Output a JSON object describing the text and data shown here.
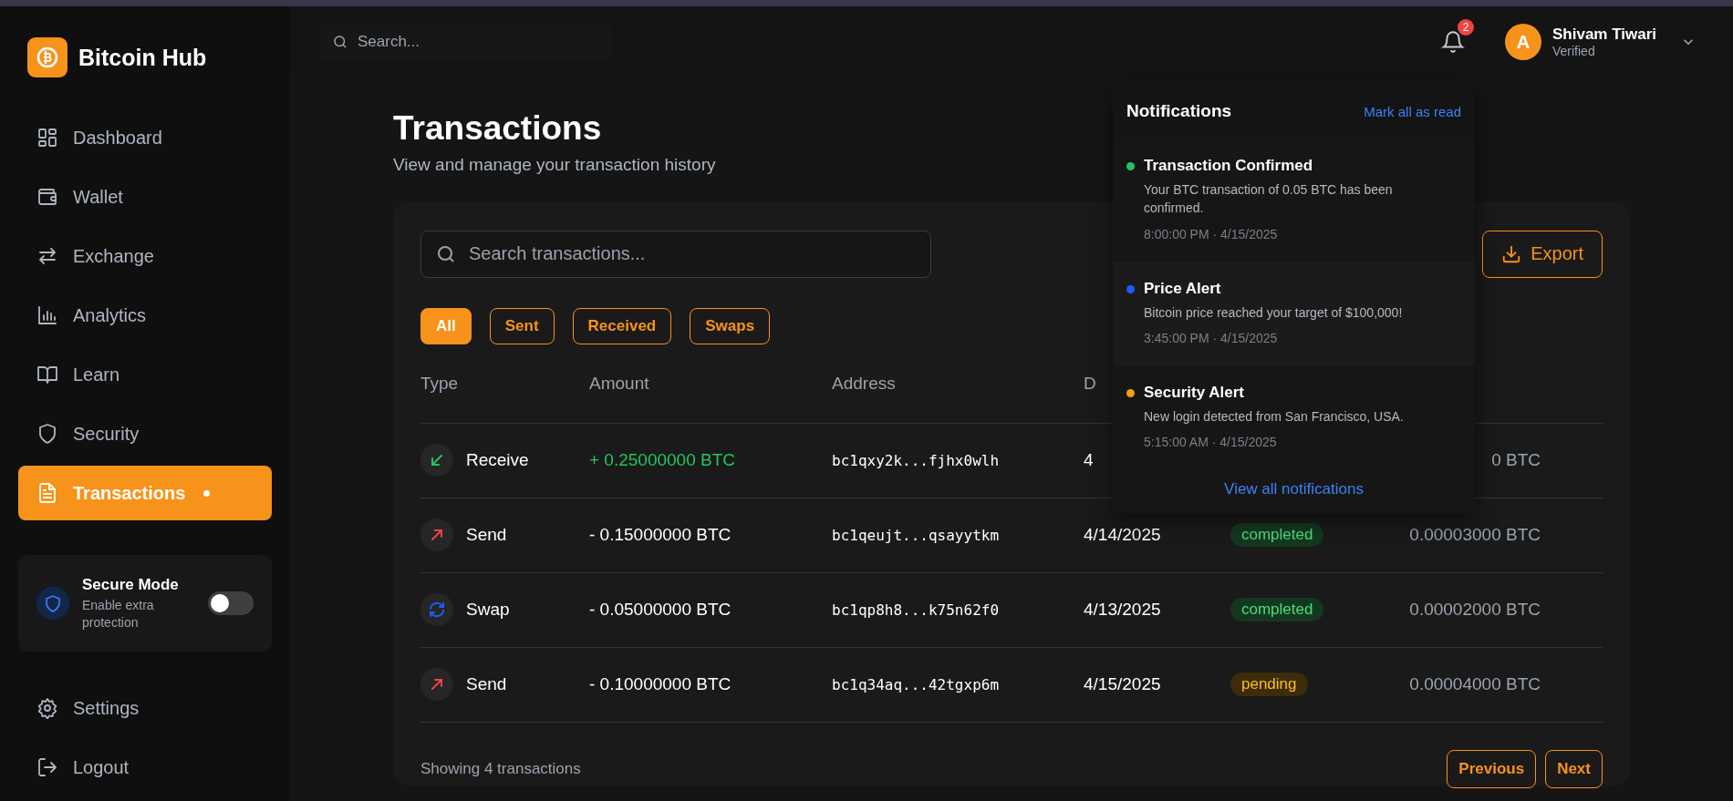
{
  "brand": {
    "name": "Bitcoin Hub"
  },
  "nav": [
    {
      "label": "Dashboard",
      "selected": false
    },
    {
      "label": "Wallet",
      "selected": false
    },
    {
      "label": "Exchange",
      "selected": false
    },
    {
      "label": "Analytics",
      "selected": false
    },
    {
      "label": "Learn",
      "selected": false
    },
    {
      "label": "Security",
      "selected": false
    },
    {
      "label": "Transactions",
      "selected": true
    }
  ],
  "secure_mode": {
    "title": "Secure Mode",
    "subtitle": "Enable extra protection",
    "on": false
  },
  "bottom_nav": [
    {
      "label": "Settings"
    },
    {
      "label": "Logout"
    }
  ],
  "top_search": {
    "placeholder": "Search..."
  },
  "notifications_badge": "2",
  "user": {
    "initial": "A",
    "name": "Shivam Tiwari",
    "status": "Verified"
  },
  "page": {
    "title": "Transactions",
    "subtitle": "View and manage your transaction history"
  },
  "tx_search": {
    "placeholder": "Search transactions..."
  },
  "export_button": "Export",
  "filters": [
    {
      "label": "All",
      "selected": true
    },
    {
      "label": "Sent",
      "selected": false
    },
    {
      "label": "Received",
      "selected": false
    },
    {
      "label": "Swaps",
      "selected": false
    }
  ],
  "columns": [
    "Type",
    "Amount",
    "Address",
    "D"
  ],
  "rows": [
    {
      "kind": "receive",
      "type": "Receive",
      "amount": "+ 0.25000000 BTC",
      "address": "bc1qxy2k...fjhx0wlh",
      "date": "4",
      "fee": "0 BTC"
    },
    {
      "kind": "send",
      "type": "Send",
      "amount": "- 0.15000000 BTC",
      "address": "bc1qeujt...qsayytkm",
      "date": "4/14/2025",
      "status": "completed",
      "fee": "0.00003000 BTC"
    },
    {
      "kind": "swap",
      "type": "Swap",
      "amount": "- 0.05000000 BTC",
      "address": "bc1qp8h8...k75n62f0",
      "date": "4/13/2025",
      "status": "completed",
      "fee": "0.00002000 BTC"
    },
    {
      "kind": "send",
      "type": "Send",
      "amount": "- 0.10000000 BTC",
      "address": "bc1q34aq...42tgxp6m",
      "date": "4/15/2025",
      "status": "pending",
      "fee": "0.00004000 BTC"
    }
  ],
  "footer": {
    "count": "Showing 4 transactions",
    "buttons": [
      "Previous",
      "Next"
    ]
  },
  "notifications": {
    "title": "Notifications",
    "mark_all": "Mark all as read",
    "view_all": "View all notifications",
    "items": [
      {
        "title": "Transaction Confirmed",
        "body": "Your BTC transaction of 0.05 BTC has been confirmed.",
        "time": "8:00:00 PM · 4/15/2025",
        "color": "#22c55e"
      },
      {
        "title": "Price Alert",
        "body": "Bitcoin price reached your target of $100,000!",
        "time": "3:45:00 PM · 4/15/2025",
        "color": "#1d5cff"
      },
      {
        "title": "Security Alert",
        "body": "New login detected from San Francisco, USA.",
        "time": "5:15:00 AM · 4/15/2025",
        "color": "#f59e0b"
      }
    ]
  }
}
